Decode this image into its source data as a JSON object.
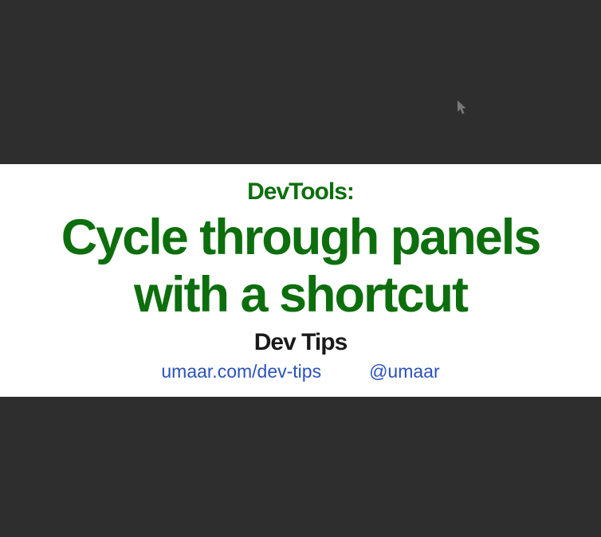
{
  "slide": {
    "category": "DevTools:",
    "title": "Cycle through panels with a shortcut",
    "subtitle": "Dev Tips",
    "links": {
      "website": "umaar.com/dev-tips",
      "twitter": "@umaar"
    }
  }
}
